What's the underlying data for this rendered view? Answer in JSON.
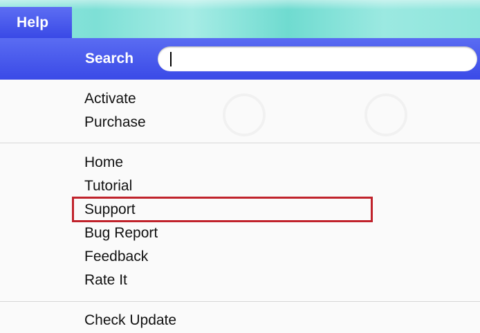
{
  "menubar": {
    "title": "Help"
  },
  "search": {
    "label": "Search",
    "value": "",
    "placeholder": ""
  },
  "groups": {
    "license": [
      "Activate",
      "Purchase"
    ],
    "info": [
      "Home",
      "Tutorial",
      "Support",
      "Bug Report",
      "Feedback",
      "Rate It"
    ],
    "update": [
      "Check Update"
    ]
  },
  "highlighted_item": "Support",
  "colors": {
    "menu_blue": "#3a4ae7",
    "menubar_teal": "#8fe5dc",
    "highlight_box": "#c0222b"
  }
}
